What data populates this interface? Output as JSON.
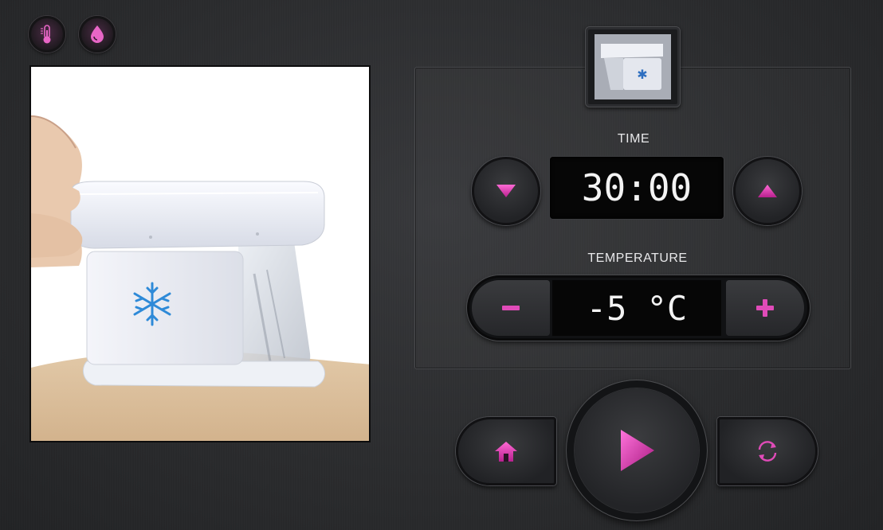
{
  "status_icons": [
    {
      "name": "thermometer-icon"
    },
    {
      "name": "water-drop-icon"
    }
  ],
  "time": {
    "label": "TIME",
    "value": "30:00",
    "decrease_icon": "triangle-down-icon",
    "increase_icon": "triangle-up-icon"
  },
  "temperature": {
    "label": "TEMPERATURE",
    "value": "-5 °C",
    "decrease_icon": "minus-icon",
    "increase_icon": "plus-icon"
  },
  "controls": {
    "home_icon": "home-icon",
    "play_icon": "play-icon",
    "reset_icon": "refresh-icon"
  },
  "colors": {
    "accent": "#e040b0",
    "accent_dark": "#8a1f6e",
    "lcd_bg": "#060606"
  }
}
